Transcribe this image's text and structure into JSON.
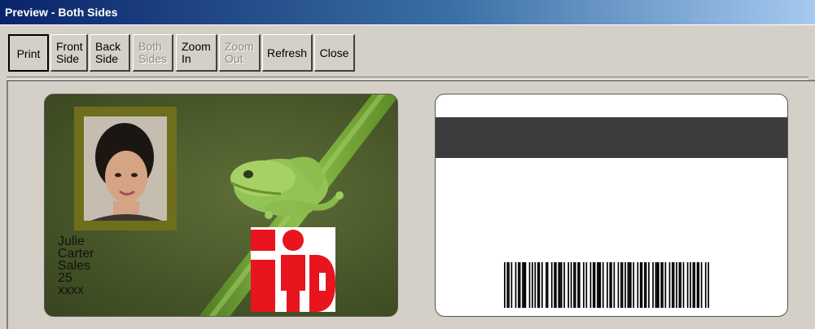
{
  "window": {
    "title": "Preview - Both Sides"
  },
  "toolbar": {
    "buttons": [
      {
        "line1": "Print",
        "line2": "",
        "enabled": true
      },
      {
        "line1": "Front",
        "line2": "Side",
        "enabled": true
      },
      {
        "line1": "Back",
        "line2": "Side",
        "enabled": true
      },
      {
        "line1": "Both",
        "line2": "Sides",
        "enabled": false
      },
      {
        "line1": "Zoom",
        "line2": "In",
        "enabled": true
      },
      {
        "line1": "Zoom",
        "line2": "Out",
        "enabled": false
      },
      {
        "line1": "Refresh",
        "line2": "",
        "enabled": true
      },
      {
        "line1": "Close",
        "line2": "",
        "enabled": true
      }
    ]
  },
  "front_card": {
    "fields": [
      "Julie",
      "Carter",
      "Sales",
      "25",
      "xxxx"
    ],
    "logo_text": "iD",
    "colors": {
      "background": "#4c5c2c",
      "photo_frame": "#6f6e1c",
      "logo_red": "#e8141e"
    }
  },
  "back_card": {
    "colors": {
      "background": "#ffffff",
      "mag_stripe": "#3c3c3c"
    },
    "barcode_bars": "1011010010110111001010101101001100101101110100101011011001010010110111010010110100101101011101001011011010010111011010010110101101001010110110100101"
  }
}
